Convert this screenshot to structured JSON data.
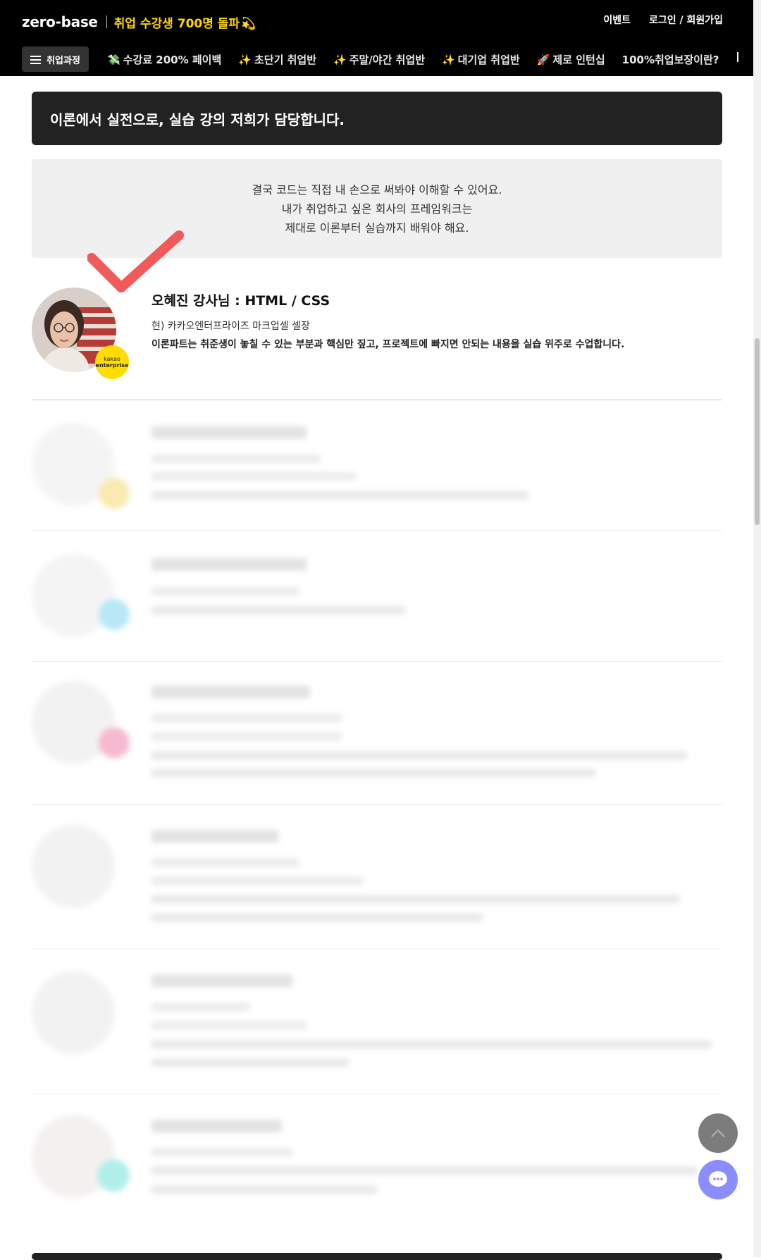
{
  "header": {
    "logo": "zero-base",
    "promo": "취업 수강생 700명 돌파",
    "promo_emoji": "💫",
    "links": [
      "이벤트",
      "로그인 / 회원가입"
    ]
  },
  "nav": {
    "menu_label": "취업과정",
    "items": [
      {
        "icon": "💸",
        "label": "수강료 200% 페이백"
      },
      {
        "icon": "✨",
        "label": "초단기 취업반"
      },
      {
        "icon": "✨",
        "label": "주말/야간 취업반"
      },
      {
        "icon": "✨",
        "label": "대기업 취업반"
      },
      {
        "icon": "🚀",
        "label": "제로 인턴십"
      },
      {
        "icon": "",
        "label": "100%취업보장이란?"
      }
    ]
  },
  "banner": {
    "title": "이론에서 실전으로, 실습 강의 저희가 담당합니다."
  },
  "intro": {
    "lines": [
      "결국 코드는 직접 내 손으로 써봐야 이해할 수 있어요.",
      "내가 취업하고 싶은 회사의 프레임워크는",
      "제대로 이론부터 실습까지 배워야 해요."
    ]
  },
  "instructor": {
    "name": "오혜진 강사님 : HTML / CSS",
    "position": "현) 카카오엔터프라이즈 마크업셀 셀장",
    "description": "이론파트는 취준생이 놓칠 수 있는 부분과 핵심만 짚고, 프로젝트에 빠지면 안되는 내용을 실습 위주로 수업합니다.",
    "badge_line1": "kakao",
    "badge_line2": "enterprise"
  },
  "colors": {
    "accent_yellow": "#ffd600",
    "check_red": "#f25a5a",
    "chat_purple": "#8b8cff"
  }
}
